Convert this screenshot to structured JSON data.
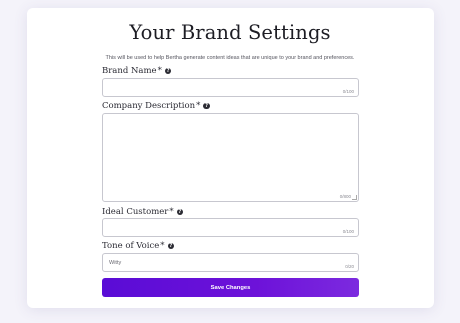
{
  "page": {
    "title": "Your Brand Settings",
    "subtitle": "This will be used to help Bertha generate content ideas that are unique to your brand and preferences."
  },
  "fields": {
    "brand_name": {
      "label": "Brand Name",
      "required_mark": "*",
      "value": "",
      "counter": "0/100"
    },
    "company_description": {
      "label": "Company Description",
      "required_mark": "*",
      "value": "",
      "counter": "0/800"
    },
    "ideal_customer": {
      "label": "Ideal Customer",
      "required_mark": "*",
      "value": "",
      "counter": "0/100"
    },
    "tone_of_voice": {
      "label": "Tone of Voice",
      "required_mark": "*",
      "value": "Witty",
      "counter": "0/20"
    }
  },
  "help_icon_glyph": "?",
  "actions": {
    "save_label": "Save Changes"
  },
  "colors": {
    "accent": "#6410d8",
    "background": "#f4f3fa"
  }
}
